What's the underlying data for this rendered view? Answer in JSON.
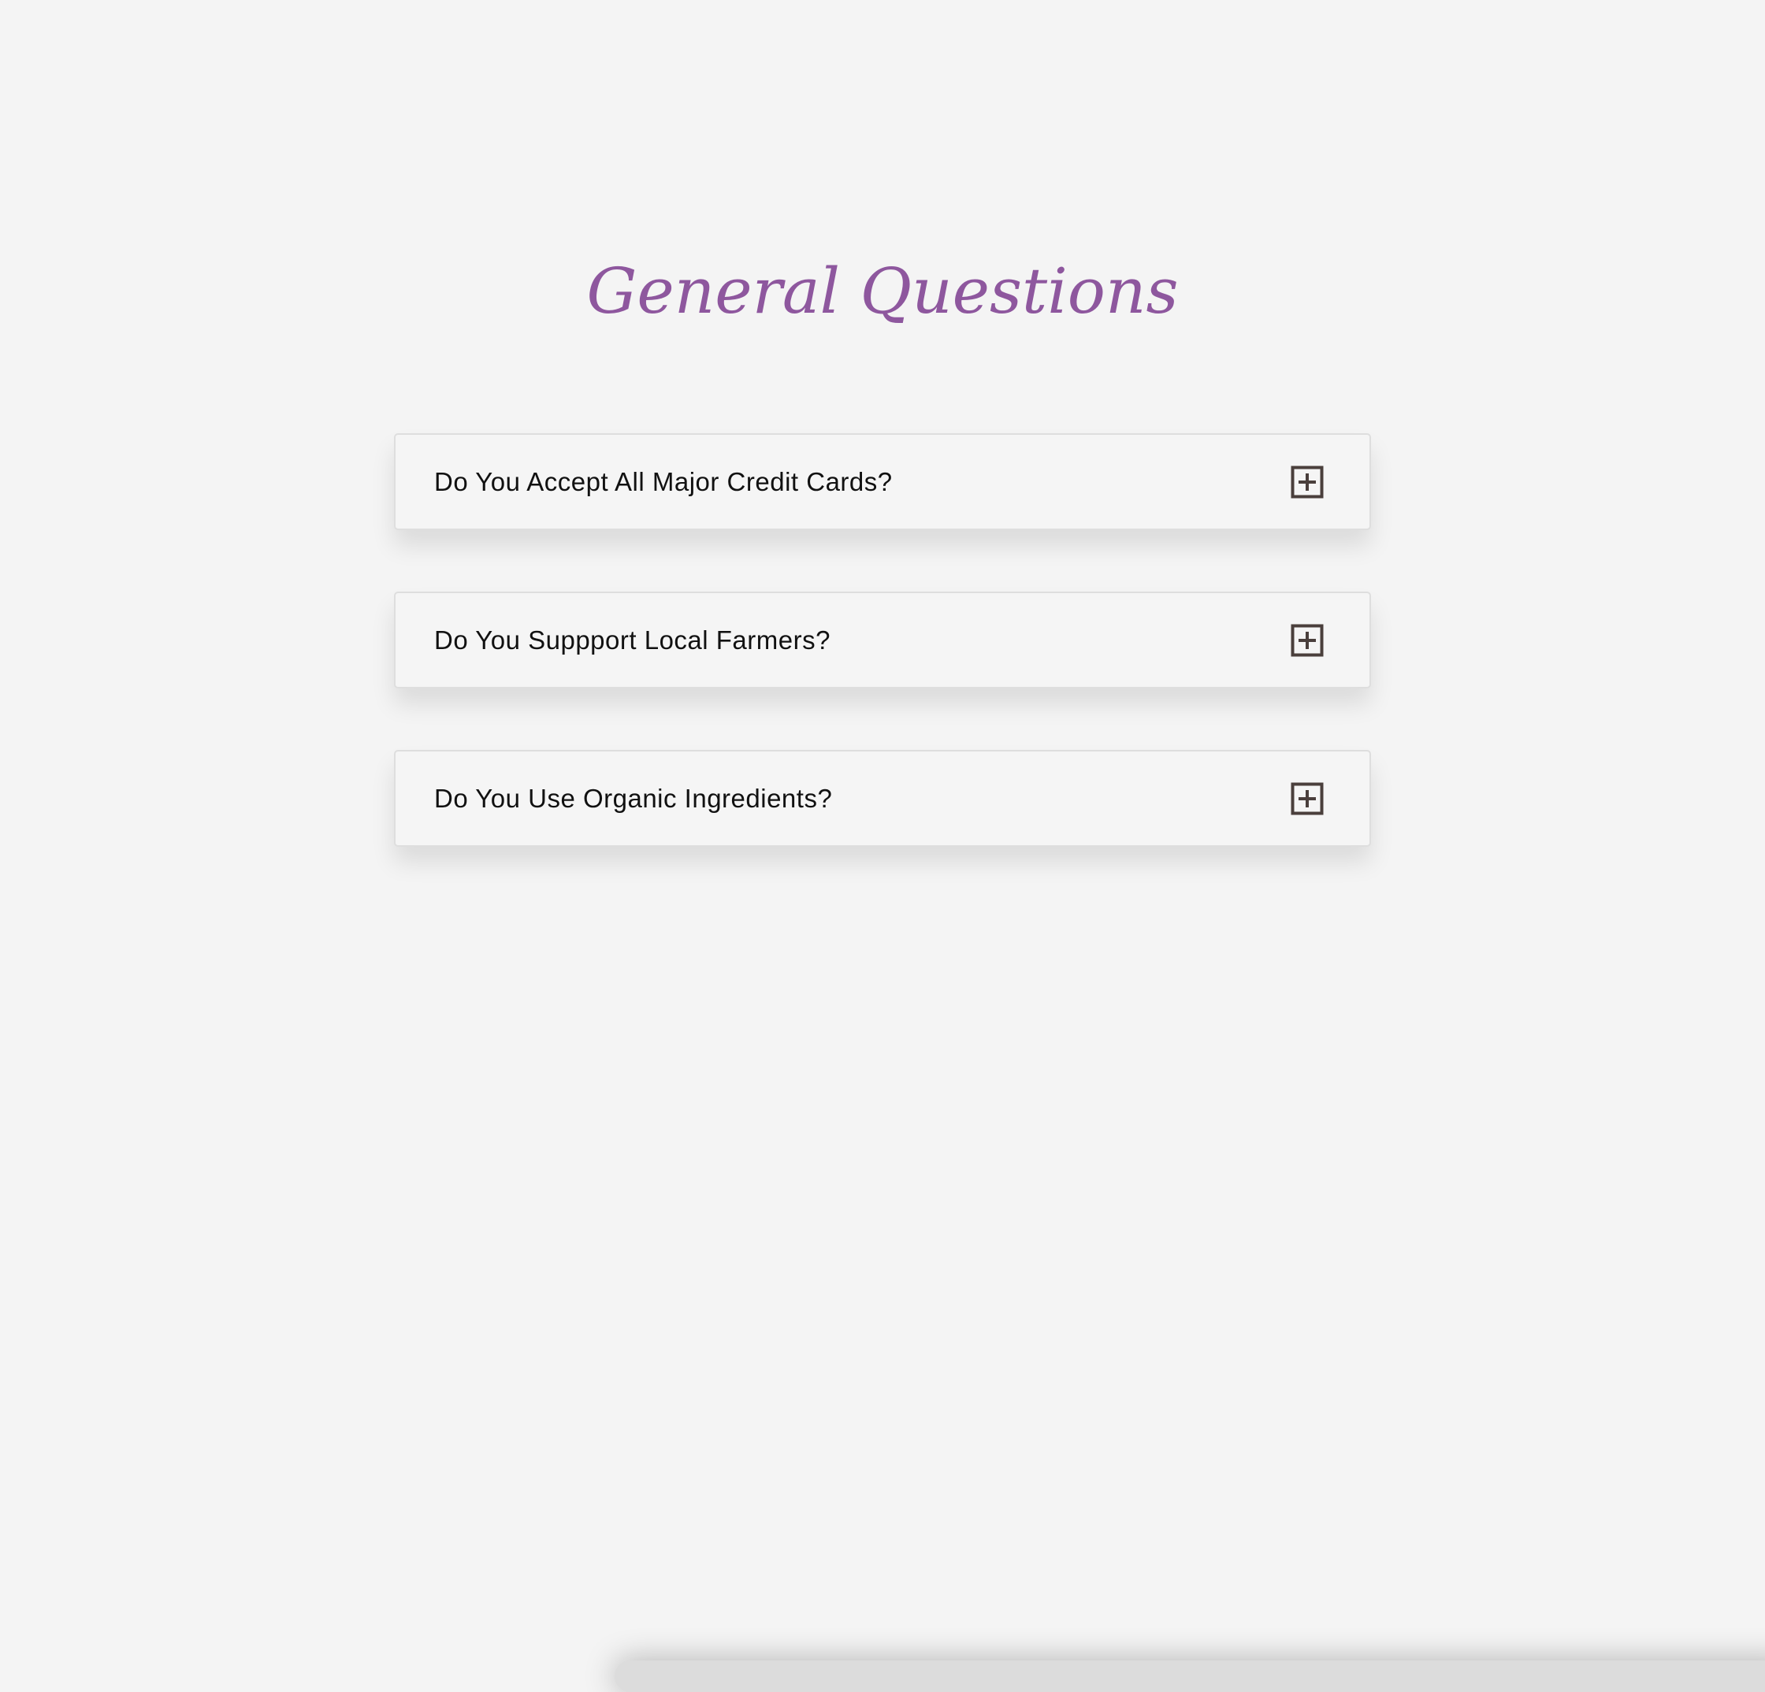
{
  "page": {
    "title": "General Questions",
    "title_color": "#8e579e"
  },
  "faq": {
    "items": [
      {
        "question": "Do You Accept All Major Credit Cards?",
        "icon": "plus-square-icon"
      },
      {
        "question": "Do You Suppport Local Farmers?",
        "icon": "plus-square-icon"
      },
      {
        "question": "Do You Use Organic Ingredients?",
        "icon": "plus-square-icon"
      }
    ]
  }
}
